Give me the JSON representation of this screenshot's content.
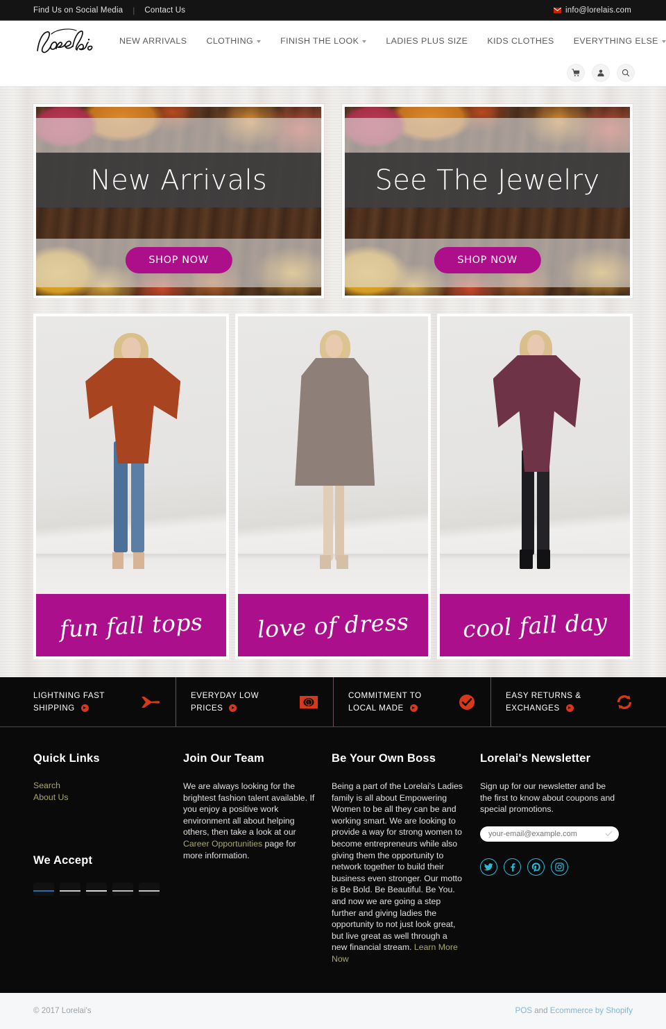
{
  "topbar": {
    "social_link": "Find Us on Social Media",
    "contact_link": "Contact Us",
    "email": "info@lorelais.com"
  },
  "header": {
    "logo_text": "lorelai's",
    "nav": [
      {
        "label": "NEW ARRIVALS",
        "has_dropdown": false
      },
      {
        "label": "CLOTHING",
        "has_dropdown": true
      },
      {
        "label": "FINISH THE LOOK",
        "has_dropdown": true
      },
      {
        "label": "LADIES PLUS SIZE",
        "has_dropdown": false
      },
      {
        "label": "KIDS CLOTHES",
        "has_dropdown": false
      },
      {
        "label": "EVERYTHING ELSE",
        "has_dropdown": true
      }
    ],
    "icons": [
      "cart-icon",
      "account-icon",
      "search-icon"
    ]
  },
  "promos": [
    {
      "title": "New Arrivals",
      "cta": "SHOP NOW"
    },
    {
      "title": "See The Jewelry",
      "cta": "SHOP NOW"
    }
  ],
  "categories": [
    {
      "label": "fun fall tops",
      "garment_color": "#a8441f",
      "pants_color": "#4d7099"
    },
    {
      "label": "love of dress",
      "garment_color": "#8e8078",
      "pants_color": "#e4e2de"
    },
    {
      "label": "cool fall day",
      "garment_color": "#6f3347",
      "pants_color": "#1d1d21"
    }
  ],
  "features": [
    {
      "line1": "LIGHTNING FAST",
      "line2": "SHIPPING",
      "icon": "airplane-icon"
    },
    {
      "line1": "EVERYDAY LOW",
      "line2": "PRICES",
      "icon": "money-bill-icon"
    },
    {
      "line1": "COMMITMENT TO",
      "line2": "LOCAL MADE",
      "icon": "check-circle-icon"
    },
    {
      "line1": "EASY RETURNS &",
      "line2": "EXCHANGES",
      "icon": "exchange-icon"
    }
  ],
  "footer": {
    "quick_links": {
      "heading": "Quick Links",
      "links": [
        "Search",
        "About Us"
      ]
    },
    "we_accept": {
      "heading": "We Accept",
      "methods": [
        "amex-card",
        "discover-card",
        "mastercard-card",
        "paypal-card",
        "visa-card"
      ]
    },
    "join_team": {
      "heading": "Join Our Team",
      "text_before": "We are always looking for the brightest fashion talent available. If you enjoy a positive work environment all about helping others, then take a look at our ",
      "link": "Career Opportunities",
      "text_after": " page for more information."
    },
    "own_boss": {
      "heading": "Be Your Own Boss",
      "text_before": "Being a part of the Lorelai's Ladies family is all about Empowering Women to be all they can be and working smart. We are looking to provide a way for strong women to become entrepreneurs while also giving them the opportunity to network together to build their business even stronger. Our motto is Be Bold. Be Beautiful. Be You. and now we are going a step further and giving ladies the opportunity to not just look great, but live great as well through a new financial stream. ",
      "link": "Learn More Now"
    },
    "newsletter": {
      "heading": "Lorelai's Newsletter",
      "text": "Sign up for our newsletter and be the first to know about coupons and special promotions.",
      "placeholder": "your-email@example.com",
      "value": "",
      "socials": [
        "twitter-icon",
        "facebook-icon",
        "pinterest-icon",
        "instagram-icon"
      ]
    }
  },
  "bottombar": {
    "copyright": "© 2017 Lorelai's",
    "pos_link": "POS",
    "and_text": " and ",
    "shopify_link": "Ecommerce by Shopify"
  },
  "colors": {
    "magenta": "#ab0f8c",
    "feature_orange": "#d8381a",
    "footer_link": "#a8a76a",
    "social_cyan": "#2fb8d8",
    "bottom_link": "#7fb7d4"
  }
}
